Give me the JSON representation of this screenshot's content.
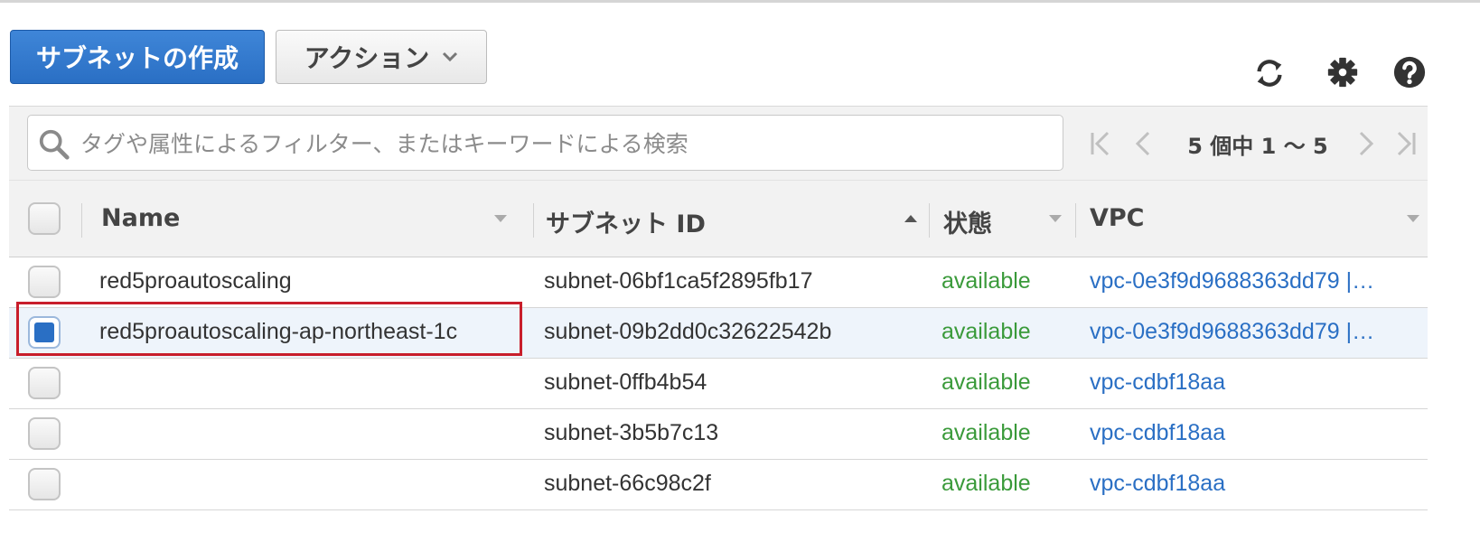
{
  "toolbar": {
    "create_label": "サブネットの作成",
    "action_label": "アクション",
    "icons": [
      "refresh-icon",
      "gear-icon",
      "help-icon"
    ]
  },
  "filter": {
    "placeholder": "タグや属性によるフィルター、またはキーワードによる検索",
    "pagination": "5 個中 1 〜 5"
  },
  "table": {
    "columns": [
      {
        "label": "Name",
        "sort": "none"
      },
      {
        "label": "サブネット ID",
        "sort": "ascending"
      },
      {
        "label": "状態",
        "sort": "none"
      },
      {
        "label": "VPC",
        "sort": "none"
      }
    ],
    "rows": [
      {
        "name": "red5proautoscaling",
        "subnet_id": "subnet-06bf1ca5f2895fb17",
        "state": "available",
        "vpc": "vpc-0e3f9d9688363dd79 |…",
        "selected": false
      },
      {
        "name": "red5proautoscaling-ap-northeast-1c",
        "subnet_id": "subnet-09b2dd0c32622542b",
        "state": "available",
        "vpc": "vpc-0e3f9d9688363dd79 |…",
        "selected": true
      },
      {
        "name": "",
        "subnet_id": "subnet-0ffb4b54",
        "state": "available",
        "vpc": "vpc-cdbf18aa",
        "selected": false
      },
      {
        "name": "",
        "subnet_id": "subnet-3b5b7c13",
        "state": "available",
        "vpc": "vpc-cdbf18aa",
        "selected": false
      },
      {
        "name": "",
        "subnet_id": "subnet-66c98c2f",
        "state": "available",
        "vpc": "vpc-cdbf18aa",
        "selected": false
      }
    ]
  },
  "colors": {
    "primary": "#2a6fc4",
    "available": "#3a9a3a",
    "link": "#2a6fc4",
    "highlight": "#c81e2b",
    "selected_row": "#eef4fb"
  }
}
